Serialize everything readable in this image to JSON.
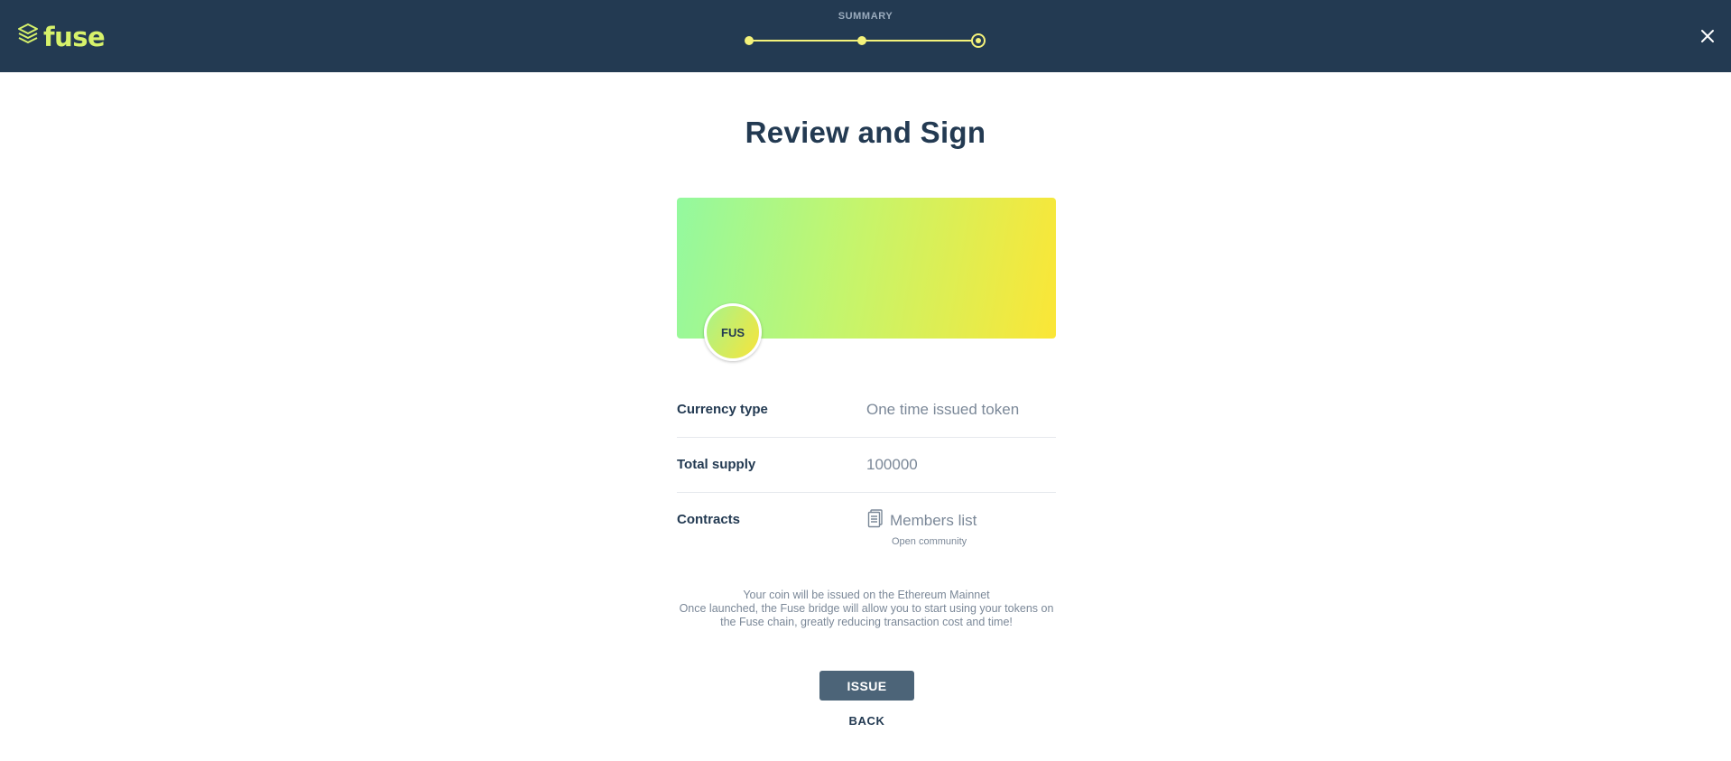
{
  "header": {
    "logo_text": "fuse",
    "step_label": "SUMMARY",
    "steps_total": 3,
    "current_step": 3,
    "brand_color": "#d7f26b",
    "bar_color": "#233a52"
  },
  "main": {
    "title": "Review and Sign",
    "token_symbol": "FUS",
    "details": [
      {
        "label": "Currency type",
        "value": "One time issued token"
      },
      {
        "label": "Total supply",
        "value": "100000"
      },
      {
        "label": "Contracts",
        "value": "Members list",
        "sub": "Open community"
      }
    ],
    "notice": "Your coin will be issued on the Ethereum Mainnet\nOnce launched, the Fuse bridge will allow you to start using your tokens on the Fuse chain, greatly reducing transaction cost and time!",
    "notice_line1": "Your coin will be issued on the Ethereum Mainnet",
    "notice_line2": "Once launched, the Fuse bridge will allow you to start using your tokens on the Fuse chain, greatly reducing transaction cost and time!",
    "issue_label": "ISSUE",
    "back_label": "BACK"
  },
  "icons": {
    "logo": "layers-icon",
    "close": "close-icon",
    "contract": "document-icon"
  }
}
